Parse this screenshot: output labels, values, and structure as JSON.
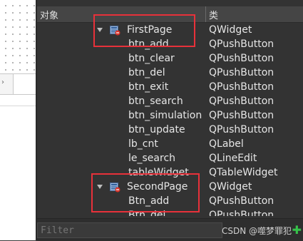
{
  "header": {
    "col_object": "对象",
    "col_class": "类"
  },
  "rows": [
    {
      "name": "FirstPage",
      "cls": "QWidget",
      "expanded": true,
      "icon": "widget-icon"
    },
    {
      "name": "btn_add",
      "cls": "QPushButton"
    },
    {
      "name": "btn_clear",
      "cls": "QPushButton"
    },
    {
      "name": "btn_del",
      "cls": "QPushButton"
    },
    {
      "name": "btn_exit",
      "cls": "QPushButton"
    },
    {
      "name": "btn_search",
      "cls": "QPushButton"
    },
    {
      "name": "btn_simulation",
      "cls": "QPushButton"
    },
    {
      "name": "btn_update",
      "cls": "QPushButton"
    },
    {
      "name": "lb_cnt",
      "cls": "QLabel"
    },
    {
      "name": "le_search",
      "cls": "QLineEdit"
    },
    {
      "name": "tableWidget",
      "cls": "QTableWidget"
    },
    {
      "name": "SecondPage",
      "cls": "QWidget",
      "expanded": true,
      "icon": "widget-icon"
    },
    {
      "name": "Btn_add",
      "cls": "QPushButton"
    },
    {
      "name": "Btn_del",
      "cls": "QPushButton"
    }
  ],
  "filter": {
    "placeholder": "Filter"
  },
  "watermark": "CSDN @噬梦罪犯",
  "left_panel": {
    "arrow_glyph": "›"
  },
  "colors": {
    "highlight": "#e8313a",
    "background": "#333333",
    "text": "#e6e6e6",
    "plus": "#36c24a"
  }
}
